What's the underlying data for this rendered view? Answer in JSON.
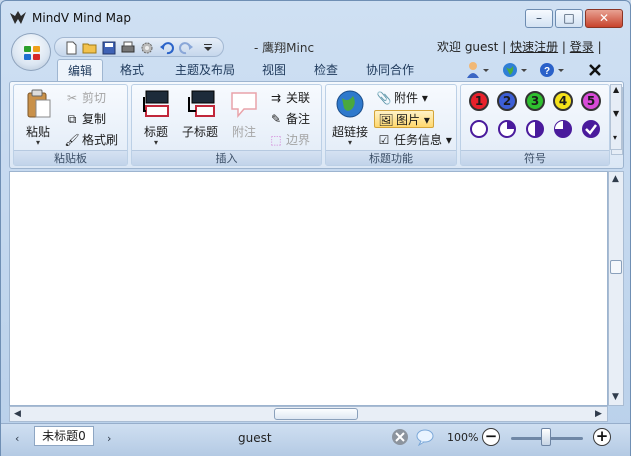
{
  "window": {
    "title": "MindV Mind Map",
    "minimize_glyph": "–",
    "maximize_glyph": "□",
    "close_glyph": "✕"
  },
  "quick_access": {
    "doc_title": "- 鹰翔Minc",
    "icons": [
      "new-doc-icon",
      "open-folder-icon",
      "save-icon",
      "print-icon",
      "settings-icon",
      "undo-icon",
      "redo-icon",
      "customize-dropdown-icon"
    ]
  },
  "account": {
    "welcome": "欢迎 guest",
    "register": "快速注册",
    "login": "登录"
  },
  "tabs": [
    {
      "label": "编辑",
      "active": true
    },
    {
      "label": "格式"
    },
    {
      "label": "主题及布局"
    },
    {
      "label": "视图"
    },
    {
      "label": "检查"
    },
    {
      "label": "协同合作"
    }
  ],
  "ribbon": {
    "clipboard": {
      "label": "粘贴板",
      "paste": "粘贴",
      "cut": "剪切",
      "copy": "复制",
      "format_painter": "格式刷"
    },
    "insert": {
      "label": "插入",
      "topic": "标题",
      "subtopic": "子标题",
      "callout": "附注",
      "relationship": "关联",
      "note": "备注",
      "boundary": "边界"
    },
    "topic_functions": {
      "label": "标题功能",
      "hyperlink": "超链接",
      "attachment": "附件",
      "picture": "图片",
      "task_info": "任务信息"
    },
    "symbols": {
      "label": "符号",
      "priority": [
        {
          "text": "1",
          "color": "#e8212b"
        },
        {
          "text": "2",
          "color": "#3d5fd6"
        },
        {
          "text": "3",
          "color": "#2fbf2f"
        },
        {
          "text": "4",
          "color": "#f5e21a"
        },
        {
          "text": "5",
          "color": "#d94ad9"
        }
      ]
    }
  },
  "statusbar": {
    "sheet_tab": "未标题0",
    "user": "guest",
    "zoom": "100%",
    "zoom_level": 1.0,
    "zoom_out": "−",
    "zoom_in": "+"
  }
}
